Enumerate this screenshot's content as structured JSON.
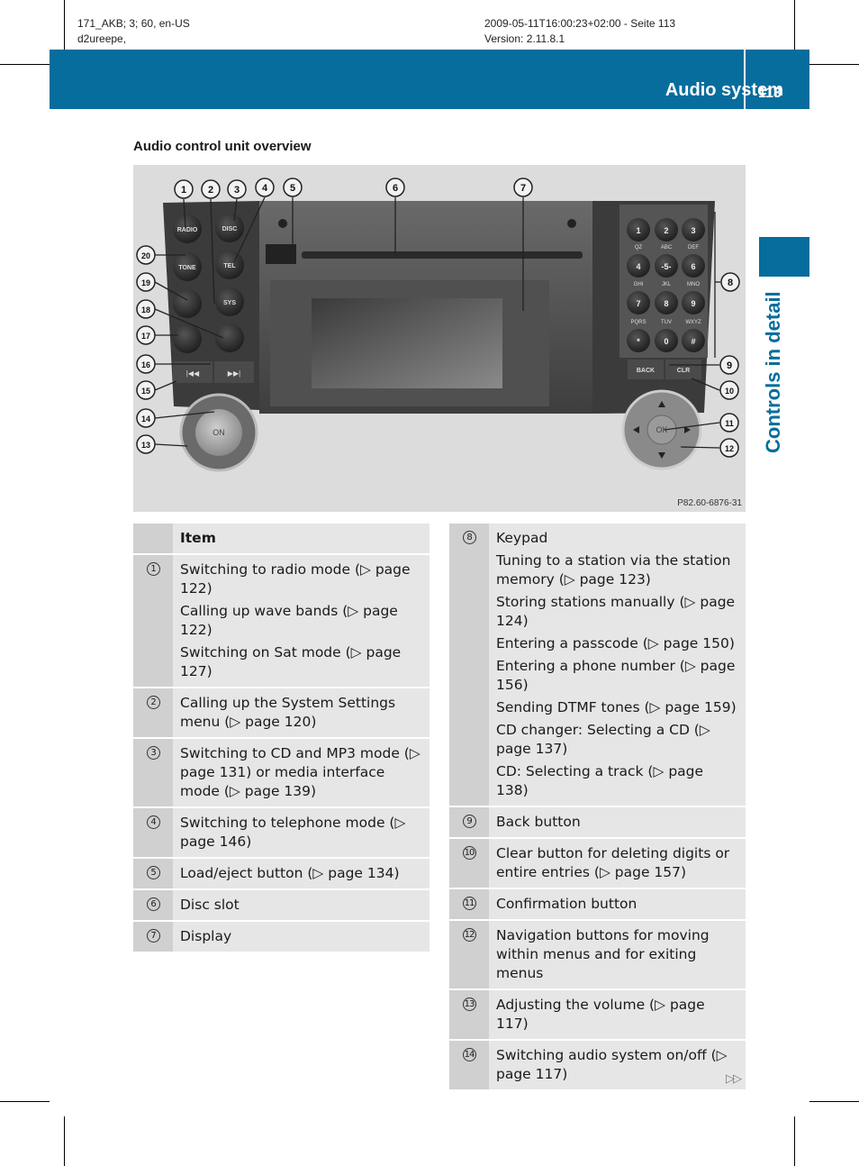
{
  "meta": {
    "left_line1": "171_AKB; 3; 60, en-US",
    "left_line2": "d2ureepe,",
    "right_line1": "2009-05-11T16:00:23+02:00 - Seite 113",
    "right_line2": "Version: 2.11.8.1"
  },
  "header": {
    "section_title": "Audio system",
    "page_number": "113",
    "accent_color": "#066d9c"
  },
  "side_tab": {
    "label": "Controls in detail"
  },
  "subheading": "Audio control unit overview",
  "photo": {
    "figure_code": "P82.60-6876-31",
    "buttons_left": [
      "RADIO",
      "DISC",
      "TONE",
      "TEL",
      "SYS"
    ],
    "skip_buttons": [
      "|◀◀",
      "▶▶|"
    ],
    "knob_label": "ON",
    "keypad": [
      {
        "key": "1",
        "sub": "QZ"
      },
      {
        "key": "2",
        "sub": "ABC"
      },
      {
        "key": "3",
        "sub": "DEF"
      },
      {
        "key": "4",
        "sub": "GHI"
      },
      {
        "key": "-5-",
        "sub": "JKL"
      },
      {
        "key": "6",
        "sub": "MNO"
      },
      {
        "key": "7",
        "sub": "PQRS"
      },
      {
        "key": "8",
        "sub": "TUV"
      },
      {
        "key": "9",
        "sub": "WXYZ"
      },
      {
        "key": "*",
        "sub": ""
      },
      {
        "key": "0",
        "sub": ""
      },
      {
        "key": "#",
        "sub": ""
      }
    ],
    "back_label": "BACK",
    "clr_label": "CLR",
    "ok_label": "OK",
    "callouts": [
      "1",
      "2",
      "3",
      "4",
      "5",
      "6",
      "7",
      "8",
      "9",
      "10",
      "11",
      "12",
      "13",
      "14",
      "15",
      "16",
      "17",
      "18",
      "19",
      "20"
    ]
  },
  "table_left": {
    "header": "Item",
    "rows": [
      {
        "num": "1",
        "lines": [
          "Switching to radio mode (▷ page 122)",
          "Calling up wave bands (▷ page 122)",
          "Switching on Sat mode (▷ page 127)"
        ]
      },
      {
        "num": "2",
        "lines": [
          "Calling up the System Settings menu (▷ page 120)"
        ]
      },
      {
        "num": "3",
        "lines": [
          "Switching to CD and MP3 mode (▷ page 131) or media interface mode (▷ page 139)"
        ]
      },
      {
        "num": "4",
        "lines": [
          "Switching to telephone mode (▷ page 146)"
        ]
      },
      {
        "num": "5",
        "lines": [
          "Load/eject button (▷ page 134)"
        ]
      },
      {
        "num": "6",
        "lines": [
          "Disc slot"
        ]
      },
      {
        "num": "7",
        "lines": [
          "Display"
        ]
      }
    ]
  },
  "table_right": {
    "rows": [
      {
        "num": "8",
        "lines": [
          "Keypad",
          "Tuning to a station via the station memory (▷ page 123)",
          "Storing stations manually (▷ page 124)",
          "Entering a passcode (▷ page 150)",
          "Entering a phone number (▷ page 156)",
          "Sending DTMF tones (▷ page 159)",
          "CD changer: Selecting a CD (▷ page 137)",
          "CD: Selecting a track (▷ page 138)"
        ]
      },
      {
        "num": "9",
        "lines": [
          "Back button"
        ]
      },
      {
        "num": "10",
        "lines": [
          "Clear button for deleting digits or entire entries (▷ page 157)"
        ]
      },
      {
        "num": "11",
        "lines": [
          "Confirmation button"
        ]
      },
      {
        "num": "12",
        "lines": [
          "Navigation buttons for moving within menus and for exiting menus"
        ]
      },
      {
        "num": "13",
        "lines": [
          "Adjusting the volume (▷ page 117)"
        ]
      },
      {
        "num": "14",
        "lines": [
          "Switching audio system on/off (▷ page 117)"
        ]
      }
    ]
  },
  "continue_marker": "▷▷"
}
